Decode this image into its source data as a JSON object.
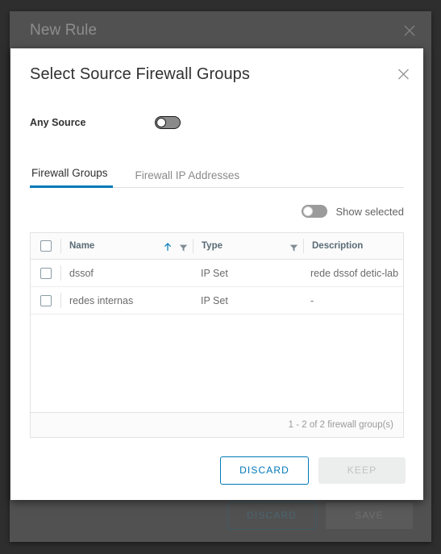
{
  "background_dialog": {
    "title": "New Rule",
    "close_icon": "close-icon",
    "buttons": {
      "discard": "DISCARD",
      "save": "SAVE"
    }
  },
  "modal": {
    "title": "Select Source Firewall Groups",
    "close_icon": "close-icon",
    "any_source": {
      "label": "Any Source",
      "state": "off"
    },
    "tabs": [
      {
        "label": "Firewall Groups",
        "active": true
      },
      {
        "label": "Firewall IP Addresses",
        "active": false
      }
    ],
    "show_selected": {
      "label": "Show selected",
      "state": "off"
    },
    "grid": {
      "columns": [
        {
          "label": "Name",
          "sort": "ascending",
          "sort_icon": "arrow-up-icon",
          "filter_icon": "filter-icon"
        },
        {
          "label": "Type",
          "sort": "none",
          "filter_icon": "filter-icon"
        },
        {
          "label": "Description",
          "sort": "none"
        }
      ],
      "rows": [
        {
          "selected": false,
          "name": "dssof",
          "type": "IP Set",
          "description": "rede dssof detic-lab"
        },
        {
          "selected": false,
          "name": "redes internas",
          "type": "IP Set",
          "description": "-"
        }
      ],
      "footer_count": "1 - 2 of 2 firewall group(s)"
    },
    "buttons": {
      "discard": "DISCARD",
      "keep": "KEEP"
    }
  },
  "colors": {
    "accent": "#0079b8",
    "backdrop": "#2e2e2e",
    "dialog_gray": "#515151"
  }
}
